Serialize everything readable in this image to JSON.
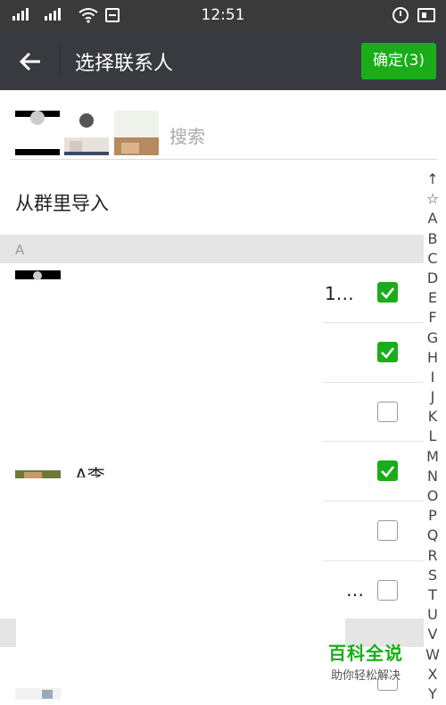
{
  "status_bar": {
    "time": "12:51",
    "network": "4G"
  },
  "header": {
    "title": "选择联系人",
    "confirm_label": "确定(3)",
    "back_icon": "arrow-left-icon"
  },
  "search": {
    "placeholder": "搜索"
  },
  "import_from_group": "从群里导入",
  "sections": [
    {
      "letter": "A"
    }
  ],
  "contacts": [
    {
      "name": "",
      "trailing": "1…",
      "checked": true
    },
    {
      "name": "",
      "trailing": "",
      "checked": true
    },
    {
      "name": "",
      "trailing": "",
      "checked": false
    },
    {
      "name": "A李",
      "trailing": "",
      "checked": true
    },
    {
      "name": "",
      "trailing": "",
      "checked": false
    },
    {
      "name": "",
      "trailing": "…",
      "checked": false
    },
    {
      "name": "",
      "trailing": "",
      "checked": false
    }
  ],
  "index_bar": [
    "↑",
    "☆",
    "A",
    "B",
    "C",
    "D",
    "E",
    "F",
    "G",
    "H",
    "I",
    "J",
    "K",
    "L",
    "M",
    "N",
    "O",
    "P",
    "Q",
    "R",
    "S",
    "T",
    "U",
    "V",
    "W",
    "X",
    "Y"
  ],
  "watermark": {
    "title": "百科全说",
    "subtitle": "助你轻松解决"
  },
  "colors": {
    "accent": "#1aad19",
    "titlebar": "#393a3f",
    "statusbar": "#3a3a3a"
  }
}
